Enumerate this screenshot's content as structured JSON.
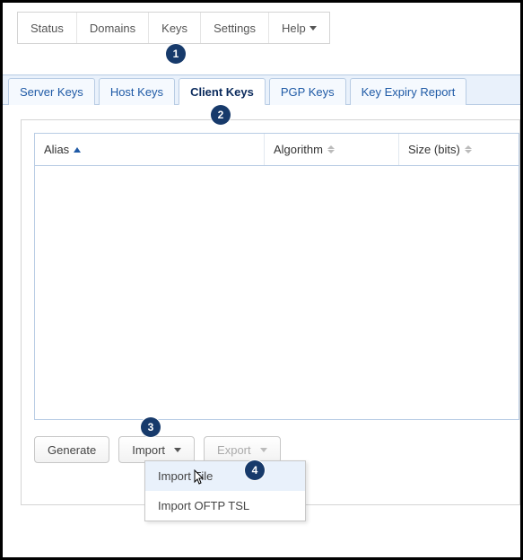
{
  "topnav": {
    "items": [
      {
        "label": "Status"
      },
      {
        "label": "Domains"
      },
      {
        "label": "Keys"
      },
      {
        "label": "Settings"
      },
      {
        "label": "Help"
      }
    ]
  },
  "tabs": [
    {
      "label": "Server Keys"
    },
    {
      "label": "Host Keys"
    },
    {
      "label": "Client Keys"
    },
    {
      "label": "PGP Keys"
    },
    {
      "label": "Key Expiry Report"
    }
  ],
  "grid": {
    "columns": {
      "alias": "Alias",
      "algorithm": "Algorithm",
      "size": "Size (bits)"
    }
  },
  "buttons": {
    "generate": "Generate",
    "import": "Import",
    "export": "Export"
  },
  "import_menu": {
    "file": "Import File",
    "oftp": "Import OFTP TSL"
  },
  "callouts": {
    "1": "1",
    "2": "2",
    "3": "3",
    "4": "4"
  }
}
